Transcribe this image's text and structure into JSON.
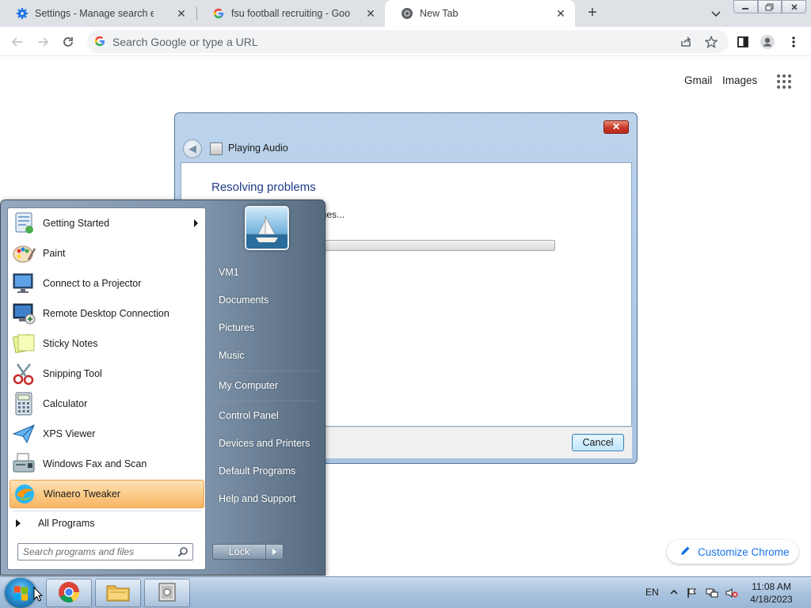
{
  "browser": {
    "tabs": [
      {
        "title": "Settings - Manage search engine",
        "icon": "gear-icon"
      },
      {
        "title": "fsu football recruiting - Google S",
        "icon": "google-icon"
      },
      {
        "title": "New Tab",
        "icon": "chrome-icon"
      }
    ],
    "omnibox_placeholder": "Search Google or type a URL",
    "ntp_links": {
      "gmail": "Gmail",
      "images": "Images"
    },
    "customize_label": "Customize Chrome"
  },
  "dialog": {
    "app_title": "Playing Audio",
    "heading": "Resolving problems",
    "status": "nges...",
    "cancel_label": "Cancel",
    "progress": 0
  },
  "start_menu": {
    "programs": [
      {
        "label": "Getting Started",
        "icon": "getting-started-icon",
        "has_submenu": true
      },
      {
        "label": "Paint",
        "icon": "paint-icon"
      },
      {
        "label": "Connect to a Projector",
        "icon": "projector-icon"
      },
      {
        "label": "Remote Desktop Connection",
        "icon": "remote-desktop-icon"
      },
      {
        "label": "Sticky Notes",
        "icon": "sticky-notes-icon"
      },
      {
        "label": "Snipping Tool",
        "icon": "snipping-tool-icon"
      },
      {
        "label": "Calculator",
        "icon": "calculator-icon"
      },
      {
        "label": "XPS Viewer",
        "icon": "xps-viewer-icon"
      },
      {
        "label": "Windows Fax and Scan",
        "icon": "fax-scan-icon"
      },
      {
        "label": "Winaero Tweaker",
        "icon": "winaero-tweaker-icon",
        "highlighted": true
      }
    ],
    "all_programs": "All Programs",
    "search_placeholder": "Search programs and files",
    "right_links": [
      "VM1",
      "Documents",
      "Pictures",
      "Music",
      "My Computer",
      "Control Panel",
      "Devices and Printers",
      "Default Programs",
      "Help and Support"
    ],
    "lock_label": "Lock"
  },
  "taskbar": {
    "pinned": [
      "chrome-icon",
      "explorer-icon",
      "troubleshooter-icon"
    ],
    "language": "EN",
    "time": "11:08 AM",
    "date": "4/18/2023"
  }
}
